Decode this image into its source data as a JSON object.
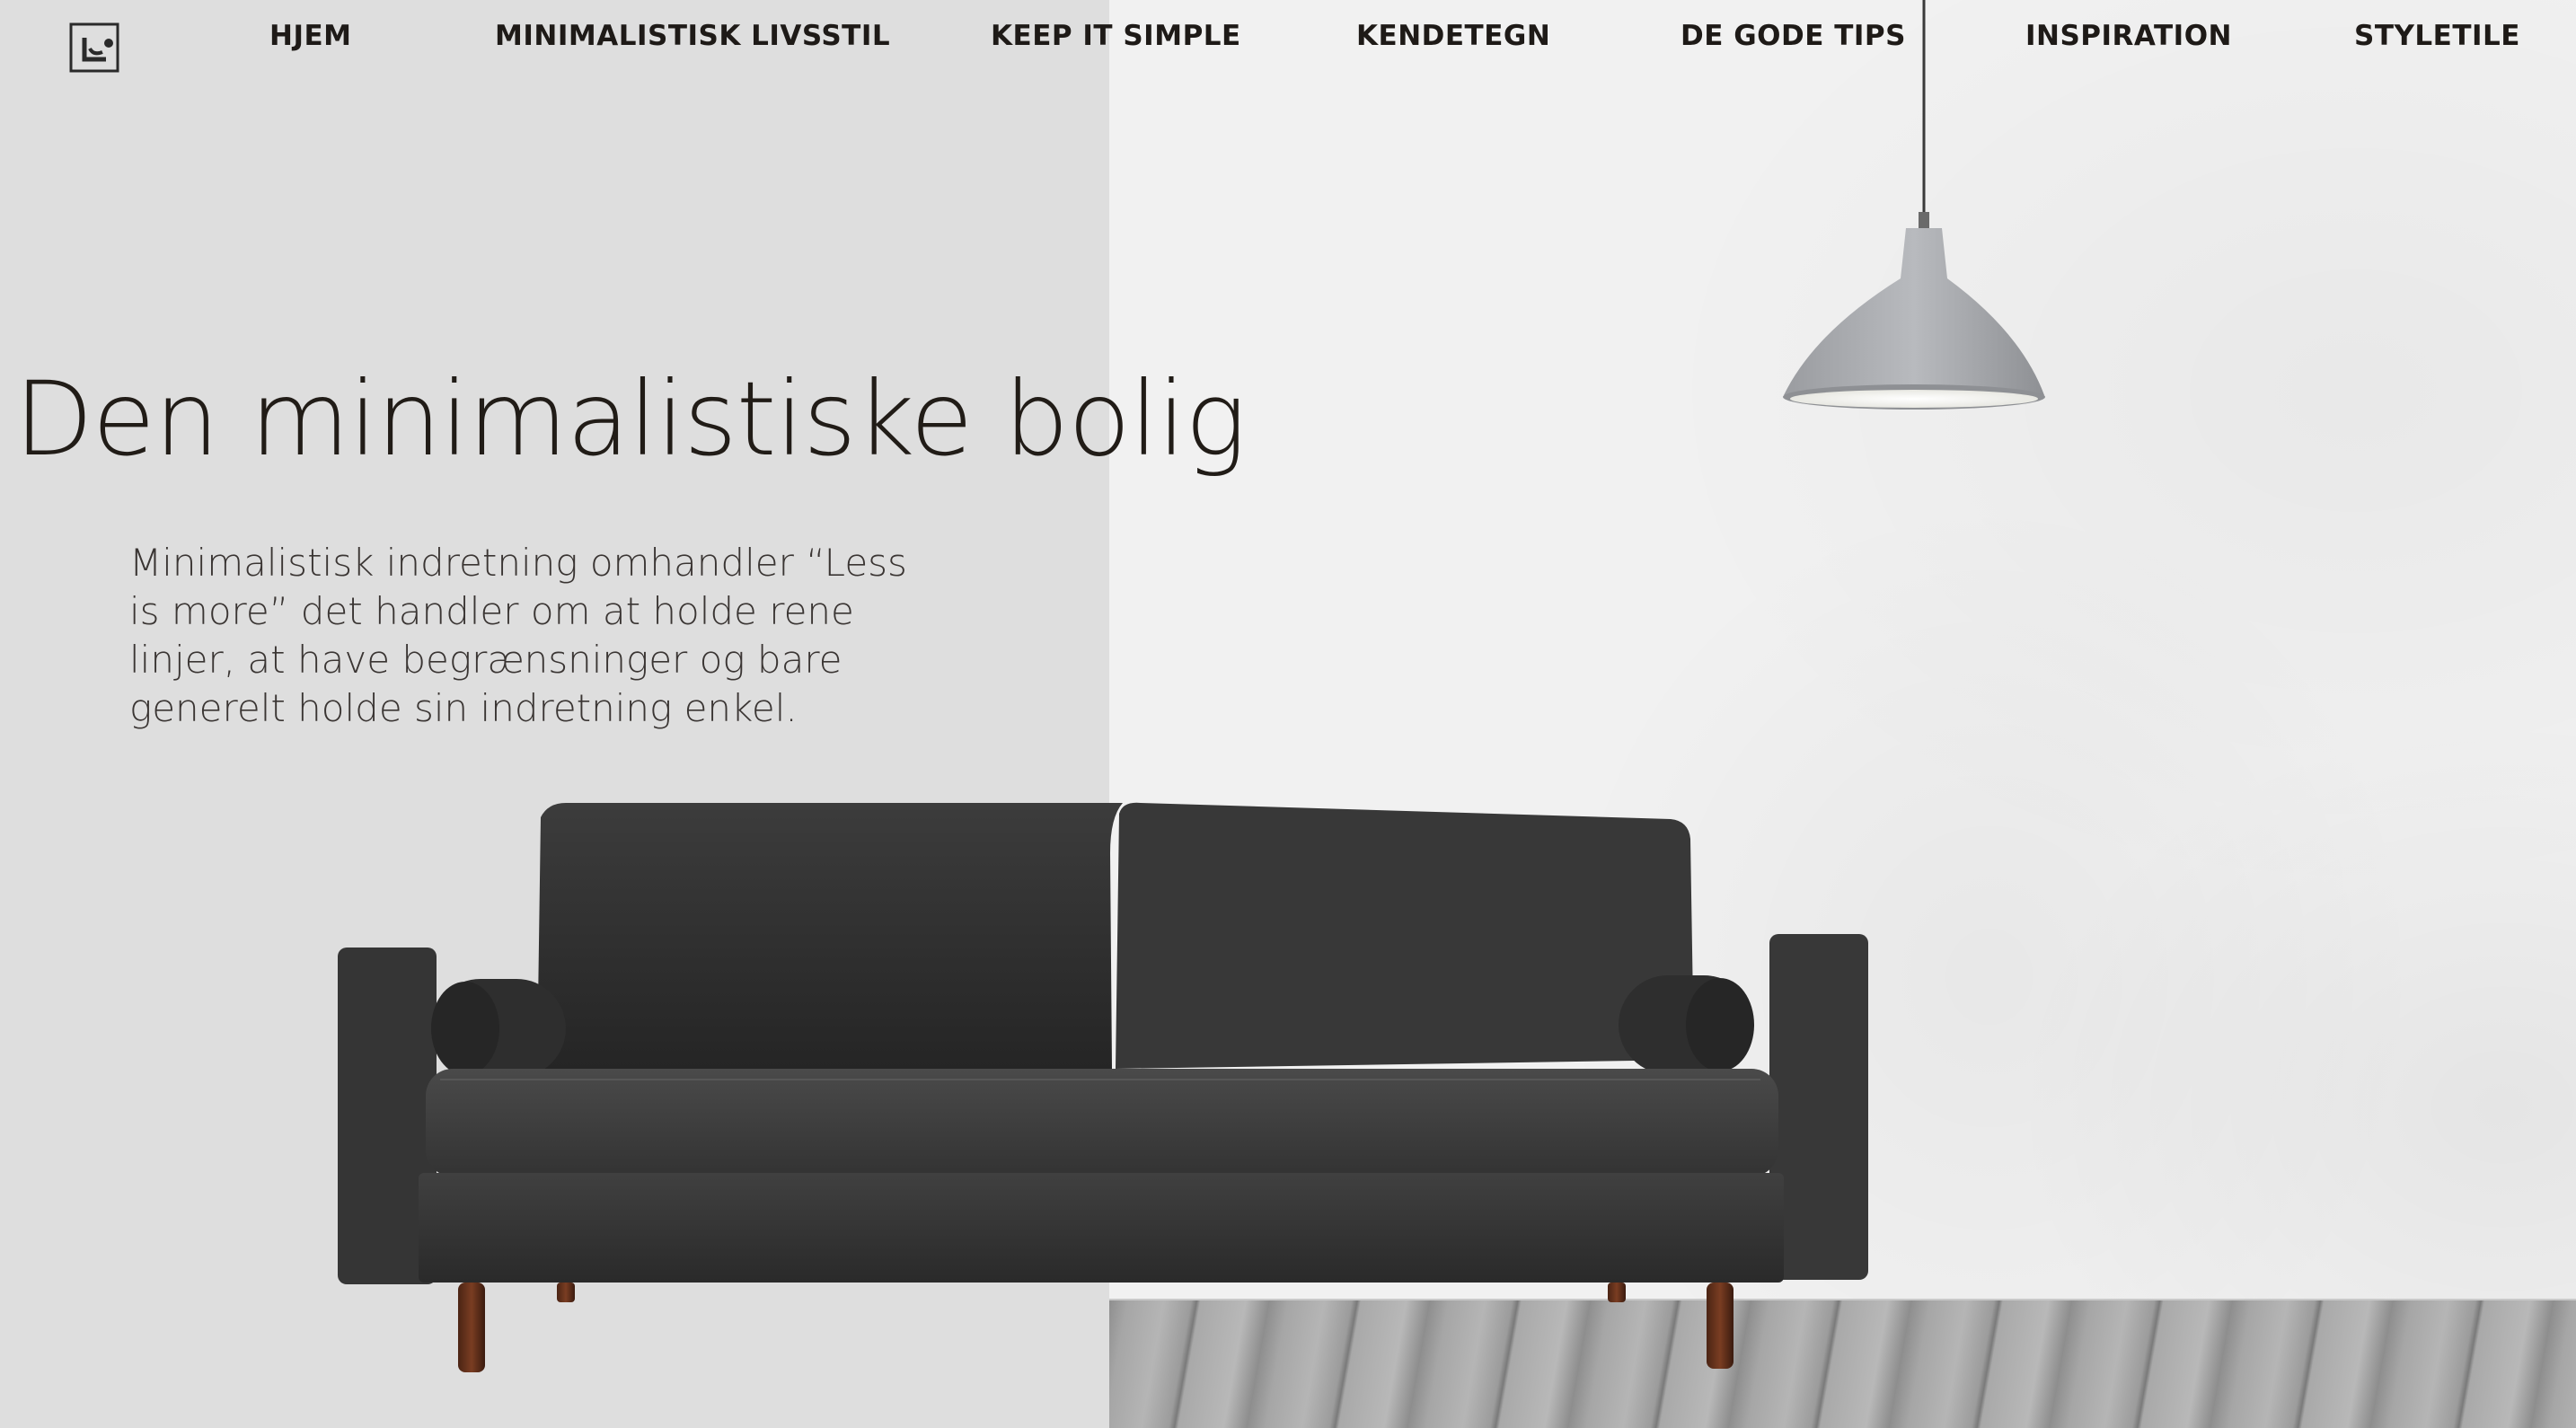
{
  "nav": {
    "items": [
      {
        "label": "HJEM"
      },
      {
        "label": "MINIMALISTISK LIVSSTIL"
      },
      {
        "label": "KEEP IT SIMPLE"
      },
      {
        "label": "KENDETEGN"
      },
      {
        "label": "DE GODE TIPS"
      },
      {
        "label": "INSPIRATION"
      },
      {
        "label": "STYLETILE"
      }
    ]
  },
  "hero": {
    "title": "Den minimalistiske bolig",
    "text": "Minimalistisk indretning omhandler “Less is more” det handler om at holde rene linjer, at have begrænsninger og bare generelt holde sin indretning enkel."
  },
  "icons": {
    "logo": "logo-icon",
    "lamp": "pendant-lamp",
    "sofa": "sofa"
  },
  "colors": {
    "left_panel": "#dedede",
    "wall": "#f1f1f1",
    "text": "#1e1a17",
    "sofa": "#2f2f2f"
  }
}
